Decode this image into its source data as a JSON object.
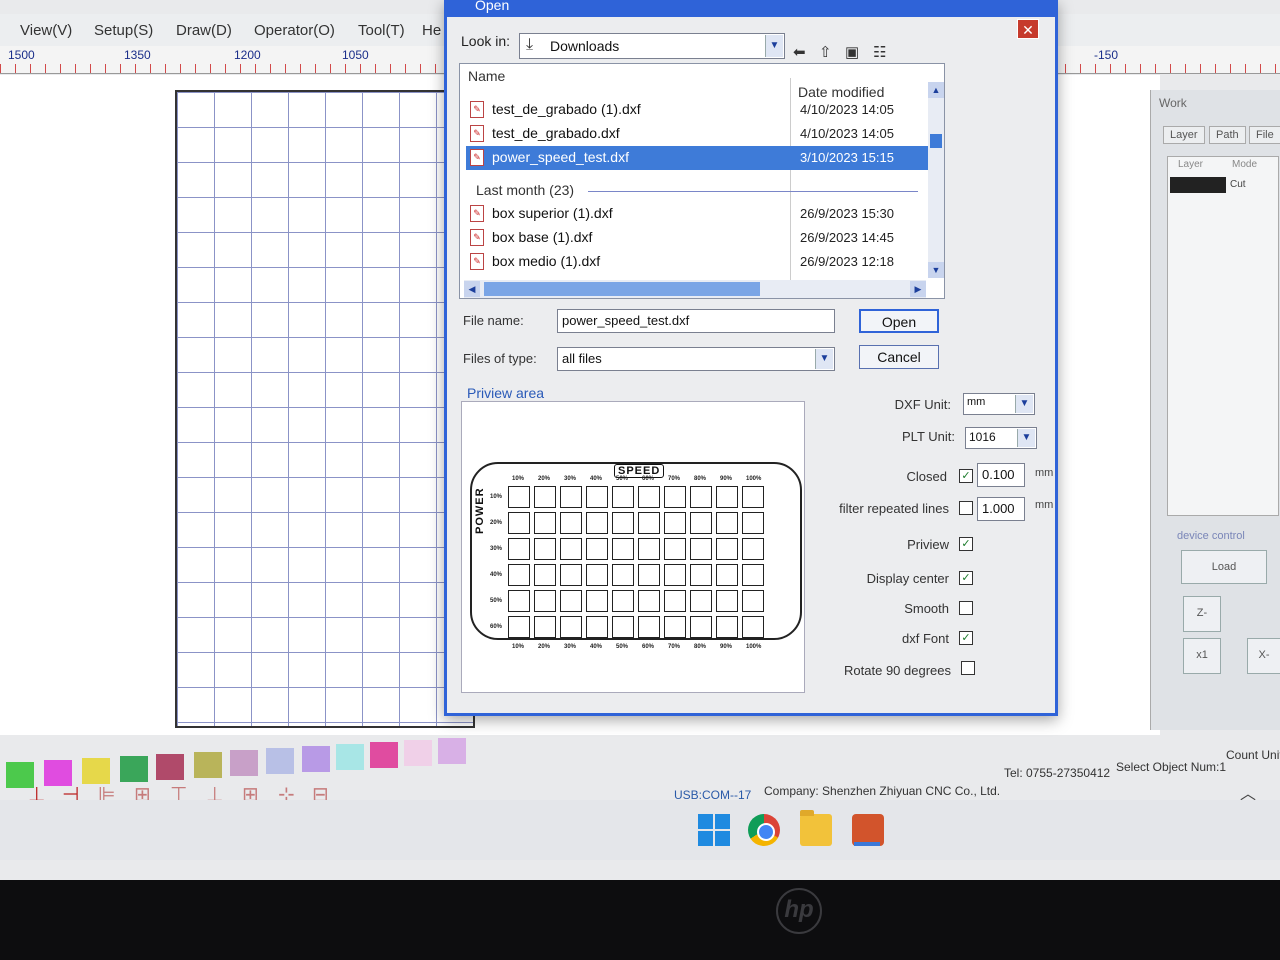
{
  "app": {
    "menu": [
      "View(V)",
      "Setup(S)",
      "Draw(D)",
      "Operator(O)",
      "Tool(T)",
      "He"
    ],
    "ruler": [
      "1500",
      "1350",
      "1200",
      "1050",
      "-150"
    ],
    "right_panel": {
      "title": "Work",
      "tabs": [
        "Layer",
        "Path",
        "File"
      ],
      "columns": [
        "Layer",
        "Mode"
      ],
      "row_mode": "Cut",
      "section": "device control",
      "buttons": {
        "load": "Load",
        "z_minus": "Z-",
        "x1": "x1",
        "x_minus": "X-"
      }
    },
    "palette_colors": [
      "#4cc94c",
      "#e04ce0",
      "#e6d84a",
      "#3aa65a",
      "#b04a6a",
      "#b9b45a",
      "#c8a0c8",
      "#b8c0e6",
      "#b89ae6",
      "#a8e6e6",
      "#e04ca0",
      "#f0d0e8",
      "#d8b0e6"
    ],
    "status": {
      "port": "USB:COM--17",
      "company": "Company: Shenzhen Zhiyuan CNC Co., Ltd.",
      "tel": "Tel: 0755-27350412",
      "select": "Select Object Num:1",
      "count": "Count Unit:"
    }
  },
  "dialog": {
    "title": "Open",
    "look_in_label": "Look in:",
    "look_in_value": "Downloads",
    "columns": {
      "name": "Name",
      "date": "Date modified"
    },
    "files_recent": [
      {
        "name": "test_de_grabado (1).dxf",
        "date": "4/10/2023 14:05"
      },
      {
        "name": "test_de_grabado.dxf",
        "date": "4/10/2023 14:05"
      },
      {
        "name": "power_speed_test.dxf",
        "date": "3/10/2023 15:15"
      }
    ],
    "group_header": "Last month (23)",
    "files_last_month": [
      {
        "name": "box superior  (1).dxf",
        "date": "26/9/2023 15:30"
      },
      {
        "name": "box base (1).dxf",
        "date": "26/9/2023 14:45"
      },
      {
        "name": "box medio (1).dxf",
        "date": "26/9/2023 12:18"
      }
    ],
    "file_name_label": "File name:",
    "file_name_value": "power_speed_test.dxf",
    "files_of_type_label": "Files of type:",
    "files_of_type_value": "all files",
    "open_button": "Open",
    "cancel_button": "Cancel",
    "preview_label": "Priview area",
    "preview": {
      "speed_title": "SPEED",
      "power_title": "POWER",
      "speed_labels": [
        "10%",
        "20%",
        "30%",
        "40%",
        "50%",
        "60%",
        "70%",
        "80%",
        "90%",
        "100%"
      ],
      "power_labels": [
        "10%",
        "20%",
        "30%",
        "40%",
        "50%",
        "60%"
      ]
    },
    "options": {
      "dxf_unit_label": "DXF Unit:",
      "dxf_unit_value": "mm",
      "plt_unit_label": "PLT Unit:",
      "plt_unit_value": "1016",
      "closed_label": "Closed",
      "closed_value": "0.100",
      "filter_label": "filter repeated lines",
      "filter_value": "1.000",
      "unit_mm": "mm",
      "preview_label": "Priview",
      "display_center_label": "Display center",
      "smooth_label": "Smooth",
      "dxf_font_label": "dxf Font",
      "rotate_label": "Rotate 90 degrees",
      "checked_mark": "✓"
    }
  },
  "taskbar": {
    "icons": [
      "start-icon",
      "chrome-icon",
      "folder-icon",
      "laser-app-icon"
    ]
  },
  "bezel": {
    "logo": "hp"
  }
}
